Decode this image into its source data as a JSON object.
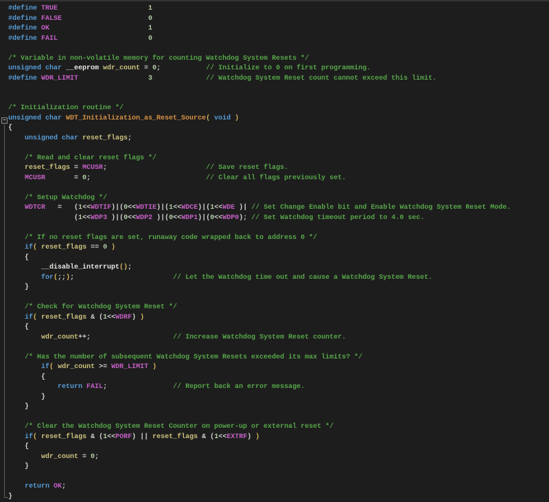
{
  "editor": {
    "language": "c",
    "fold": {
      "state": "expanded",
      "glyph": "−"
    },
    "palette": {
      "bg": "#1d1d1d",
      "keyword": "#569cd6",
      "preprocessor": "#569cd6",
      "macro": "#c45fc5",
      "number": "#b5cea8",
      "comment": "#57a64a",
      "function": "#d79145",
      "variable": "#cdc17e",
      "intrinsic": "#e8e8e4",
      "operator": "#d4d4d4",
      "paren": "#d5b45a",
      "fold_guide": "#5d5d5d"
    },
    "lines": [
      [
        [
          "pp",
          "#define "
        ],
        [
          "mac",
          "TRUE"
        ],
        [
          "num",
          "                      1"
        ]
      ],
      [
        [
          "pp",
          "#define "
        ],
        [
          "mac",
          "FALSE"
        ],
        [
          "num",
          "                     0"
        ]
      ],
      [
        [
          "pp",
          "#define "
        ],
        [
          "mac",
          "OK"
        ],
        [
          "num",
          "                        1"
        ]
      ],
      [
        [
          "pp",
          "#define "
        ],
        [
          "mac",
          "FAIL"
        ],
        [
          "num",
          "                      0"
        ]
      ],
      [],
      [
        [
          "com",
          "/* Variable in non-volatile memory for counting Watchdog System Resets */"
        ]
      ],
      [
        [
          "kw",
          "unsigned char "
        ],
        [
          "in",
          "__eeprom "
        ],
        [
          "vr",
          "wdr_count"
        ],
        [
          "op",
          " = "
        ],
        [
          "num",
          "0"
        ],
        [
          "op",
          ";"
        ],
        [
          "com",
          "           // Initialize to 0 on first programming."
        ]
      ],
      [
        [
          "pp",
          "#define "
        ],
        [
          "mac",
          "WDR_LIMIT"
        ],
        [
          "num",
          "                 3"
        ],
        [
          "com",
          "             // Watchdog System Reset count cannot exceed this limit."
        ]
      ],
      [],
      [],
      [
        [
          "com",
          "/* Initialization routine */"
        ]
      ],
      [
        [
          "kw",
          "unsigned char "
        ],
        [
          "fn",
          "WDT_Initialization_as_Reset_Source"
        ],
        [
          "pr",
          "("
        ],
        [
          "kw",
          " void "
        ],
        [
          "pr",
          ")"
        ]
      ],
      [
        [
          "op",
          "{"
        ]
      ],
      [
        [
          "op",
          "    "
        ],
        [
          "kw",
          "unsigned char "
        ],
        [
          "vr",
          "reset_flags"
        ],
        [
          "op",
          ";"
        ]
      ],
      [],
      [
        [
          "com",
          "    /* Read and clear reset flags */"
        ]
      ],
      [
        [
          "op",
          "    "
        ],
        [
          "vr",
          "reset_flags"
        ],
        [
          "op",
          " = "
        ],
        [
          "mac",
          "MCUSR"
        ],
        [
          "op",
          ";"
        ],
        [
          "com",
          "                        // Save reset flags."
        ]
      ],
      [
        [
          "op",
          "    "
        ],
        [
          "mac",
          "MCUSR"
        ],
        [
          "op",
          "       = "
        ],
        [
          "num",
          "0"
        ],
        [
          "op",
          ";"
        ],
        [
          "com",
          "                            // Clear all flags previously set."
        ]
      ],
      [],
      [
        [
          "com",
          "    /* Setup Watchdog */"
        ]
      ],
      [
        [
          "op",
          "    "
        ],
        [
          "mac",
          "WDTCR"
        ],
        [
          "op",
          "   =   ("
        ],
        [
          "num",
          "1"
        ],
        [
          "op",
          "<<"
        ],
        [
          "mac",
          "WDTIF"
        ],
        [
          "op",
          ")|("
        ],
        [
          "num",
          "0"
        ],
        [
          "op",
          "<<"
        ],
        [
          "mac",
          "WDTIE"
        ],
        [
          "op",
          ")|("
        ],
        [
          "num",
          "1"
        ],
        [
          "op",
          "<<"
        ],
        [
          "mac",
          "WDCE"
        ],
        [
          "op",
          ")|("
        ],
        [
          "num",
          "1"
        ],
        [
          "op",
          "<<"
        ],
        [
          "mac",
          "WDE "
        ],
        [
          "op",
          ")| "
        ],
        [
          "com",
          "// Set Change Enable bit and Enable Watchdog System Reset Mode."
        ]
      ],
      [
        [
          "op",
          "                ("
        ],
        [
          "num",
          "1"
        ],
        [
          "op",
          "<<"
        ],
        [
          "mac",
          "WDP3 "
        ],
        [
          "op",
          ")|("
        ],
        [
          "num",
          "0"
        ],
        [
          "op",
          "<<"
        ],
        [
          "mac",
          "WDP2 "
        ],
        [
          "op",
          ")|("
        ],
        [
          "num",
          "0"
        ],
        [
          "op",
          "<<"
        ],
        [
          "mac",
          "WDP1"
        ],
        [
          "op",
          ")|("
        ],
        [
          "num",
          "0"
        ],
        [
          "op",
          "<<"
        ],
        [
          "mac",
          "WDP0"
        ],
        [
          "op",
          ");"
        ],
        [
          "com",
          " // Set Watchdog timeout period to 4.0 sec."
        ]
      ],
      [],
      [
        [
          "com",
          "    /* If no reset flags are set, runaway code wrapped back to address 0 */"
        ]
      ],
      [
        [
          "op",
          "    "
        ],
        [
          "kw",
          "if"
        ],
        [
          "pr",
          "("
        ],
        [
          "op",
          " "
        ],
        [
          "vr",
          "reset_flags"
        ],
        [
          "op",
          " == "
        ],
        [
          "num",
          "0"
        ],
        [
          "op",
          " "
        ],
        [
          "pr",
          ")"
        ]
      ],
      [
        [
          "op",
          "    {"
        ]
      ],
      [
        [
          "op",
          "        "
        ],
        [
          "in",
          "__disable_interrupt"
        ],
        [
          "pr",
          "()"
        ],
        [
          "op",
          ";"
        ]
      ],
      [
        [
          "op",
          "        "
        ],
        [
          "kw",
          "for"
        ],
        [
          "pr",
          "("
        ],
        [
          "op",
          ";;"
        ],
        [
          "pr",
          ")"
        ],
        [
          "op",
          ";"
        ],
        [
          "com",
          "                        // Let the Watchdog time out and cause a Watchdog System Reset."
        ]
      ],
      [
        [
          "op",
          "    }"
        ]
      ],
      [],
      [
        [
          "com",
          "    /* Check for Watchdog System Reset */"
        ]
      ],
      [
        [
          "op",
          "    "
        ],
        [
          "kw",
          "if"
        ],
        [
          "pr",
          "("
        ],
        [
          "op",
          " "
        ],
        [
          "vr",
          "reset_flags"
        ],
        [
          "op",
          " & ("
        ],
        [
          "num",
          "1"
        ],
        [
          "op",
          "<<"
        ],
        [
          "mac",
          "WDRF"
        ],
        [
          "op",
          ") "
        ],
        [
          "pr",
          ")"
        ]
      ],
      [
        [
          "op",
          "    {"
        ]
      ],
      [
        [
          "op",
          "        "
        ],
        [
          "vr",
          "wdr_count"
        ],
        [
          "op",
          "++;"
        ],
        [
          "com",
          "                    // Increase Watchdog System Reset counter."
        ]
      ],
      [],
      [
        [
          "com",
          "    /* Has the number of subsequent Watchdog System Resets exceeded its max limits? */"
        ]
      ],
      [
        [
          "op",
          "        "
        ],
        [
          "kw",
          "if"
        ],
        [
          "pr",
          "("
        ],
        [
          "op",
          " "
        ],
        [
          "vr",
          "wdr_count"
        ],
        [
          "op",
          " >= "
        ],
        [
          "mac",
          "WDR_LIMIT"
        ],
        [
          "op",
          " "
        ],
        [
          "pr",
          ")"
        ]
      ],
      [
        [
          "op",
          "        {"
        ]
      ],
      [
        [
          "op",
          "            "
        ],
        [
          "kw",
          "return"
        ],
        [
          "op",
          " "
        ],
        [
          "mac",
          "FAIL"
        ],
        [
          "op",
          ";"
        ],
        [
          "com",
          "                // Report back an error message."
        ]
      ],
      [
        [
          "op",
          "        }"
        ]
      ],
      [
        [
          "op",
          "    }"
        ]
      ],
      [],
      [
        [
          "com",
          "    /* Clear the Watchdog System Reset Counter on power-up or external reset */"
        ]
      ],
      [
        [
          "op",
          "    "
        ],
        [
          "kw",
          "if"
        ],
        [
          "pr",
          "("
        ],
        [
          "op",
          " "
        ],
        [
          "vr",
          "reset_flags"
        ],
        [
          "op",
          " & ("
        ],
        [
          "num",
          "1"
        ],
        [
          "op",
          "<<"
        ],
        [
          "mac",
          "PORF"
        ],
        [
          "op",
          ") || "
        ],
        [
          "vr",
          "reset_flags"
        ],
        [
          "op",
          " & ("
        ],
        [
          "num",
          "1"
        ],
        [
          "op",
          "<<"
        ],
        [
          "mac",
          "EXTRF"
        ],
        [
          "op",
          ") "
        ],
        [
          "pr",
          ")"
        ]
      ],
      [
        [
          "op",
          "    {"
        ]
      ],
      [
        [
          "op",
          "        "
        ],
        [
          "vr",
          "wdr_count"
        ],
        [
          "op",
          " = "
        ],
        [
          "num",
          "0"
        ],
        [
          "op",
          ";"
        ]
      ],
      [
        [
          "op",
          "    }"
        ]
      ],
      [],
      [
        [
          "op",
          "    "
        ],
        [
          "kw",
          "return"
        ],
        [
          "op",
          " "
        ],
        [
          "mac",
          "OK"
        ],
        [
          "op",
          ";"
        ]
      ],
      [
        [
          "op",
          "}"
        ]
      ]
    ]
  }
}
